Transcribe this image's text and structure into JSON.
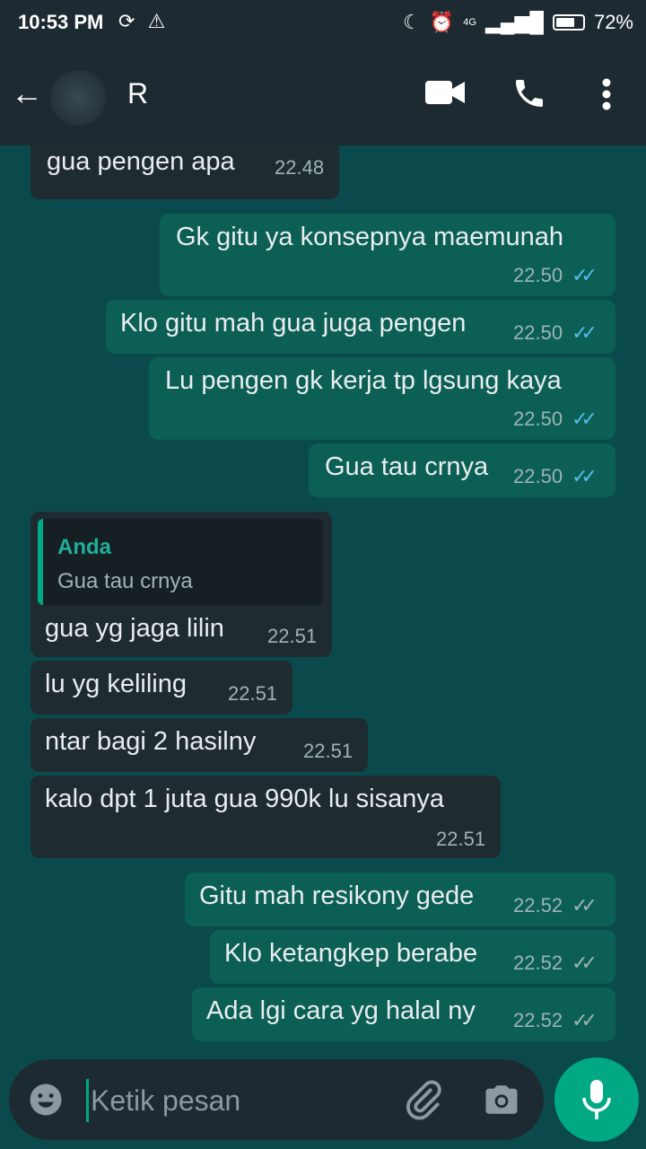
{
  "status_bar": {
    "time": "10:53 PM",
    "network": "4G",
    "battery": "72%",
    "battery_level": 0.72
  },
  "header": {
    "contact_name": "R"
  },
  "messages": [
    {
      "dir": "in",
      "text": "gua pengen apa",
      "time": "22.48"
    },
    {
      "dir": "out",
      "text": "Gk gitu ya konsepnya maemunah",
      "time": "22.50",
      "status": "read"
    },
    {
      "dir": "out",
      "text": "Klo gitu mah gua juga pengen",
      "time": "22.50",
      "status": "read"
    },
    {
      "dir": "out",
      "text": "Lu pengen gk kerja tp lgsung kaya",
      "time": "22.50",
      "status": "read"
    },
    {
      "dir": "out",
      "text": "Gua tau crnya",
      "time": "22.50",
      "status": "read"
    },
    {
      "dir": "in",
      "quote_author": "Anda",
      "quote_text": "Gua tau crnya",
      "text": "gua yg jaga lilin",
      "time": "22.51"
    },
    {
      "dir": "in",
      "text": "lu yg keliling",
      "time": "22.51"
    },
    {
      "dir": "in",
      "text": "ntar bagi 2 hasilny",
      "time": "22.51"
    },
    {
      "dir": "in",
      "text": "kalo dpt 1 juta gua 990k lu sisanya",
      "time": "22.51"
    },
    {
      "dir": "out",
      "text": "Gitu mah resikony gede",
      "time": "22.52",
      "status": "delivered"
    },
    {
      "dir": "out",
      "text": "Klo ketangkep berabe",
      "time": "22.52",
      "status": "delivered"
    },
    {
      "dir": "out",
      "text": "Ada lgi cara yg halal ny",
      "time": "22.52",
      "status": "delivered"
    }
  ],
  "composer": {
    "placeholder": "Ketik pesan"
  },
  "colors": {
    "incoming": "#1e2b31",
    "outgoing": "#0b5f54",
    "background": "#0b4a4c",
    "read_tick": "#53bdeb",
    "delivered_tick": "#9fb3b8",
    "accent": "#00a884"
  },
  "icons": {
    "back": "arrow-left-icon",
    "video": "video-call-icon",
    "call": "phone-icon",
    "menu": "more-vert-icon",
    "emoji": "emoji-icon",
    "attach": "paperclip-icon",
    "camera": "camera-icon",
    "mic": "microphone-icon"
  }
}
